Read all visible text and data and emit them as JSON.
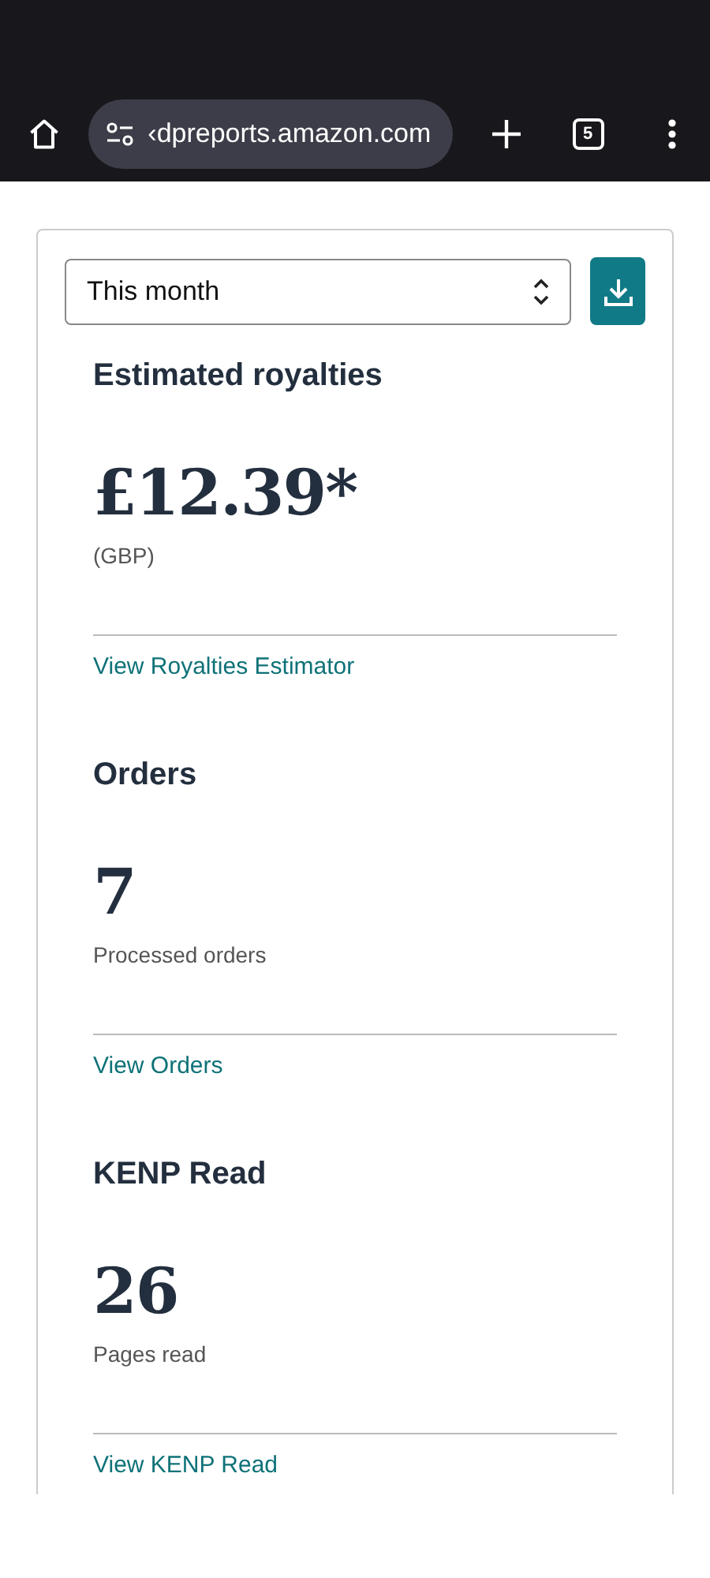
{
  "browser": {
    "url": "‹dpreports.amazon.com",
    "tab_count": "5"
  },
  "period_select": {
    "value": "This month"
  },
  "sections": [
    {
      "title": "Estimated royalties",
      "value": "£12.39*",
      "caption": "(GBP)",
      "link": "View Royalties Estimator"
    },
    {
      "title": "Orders",
      "value": "7",
      "caption": "Processed orders",
      "link": "View Orders"
    },
    {
      "title": "KENP Read",
      "value": "26",
      "caption": "Pages read",
      "link": "View KENP Read"
    }
  ]
}
